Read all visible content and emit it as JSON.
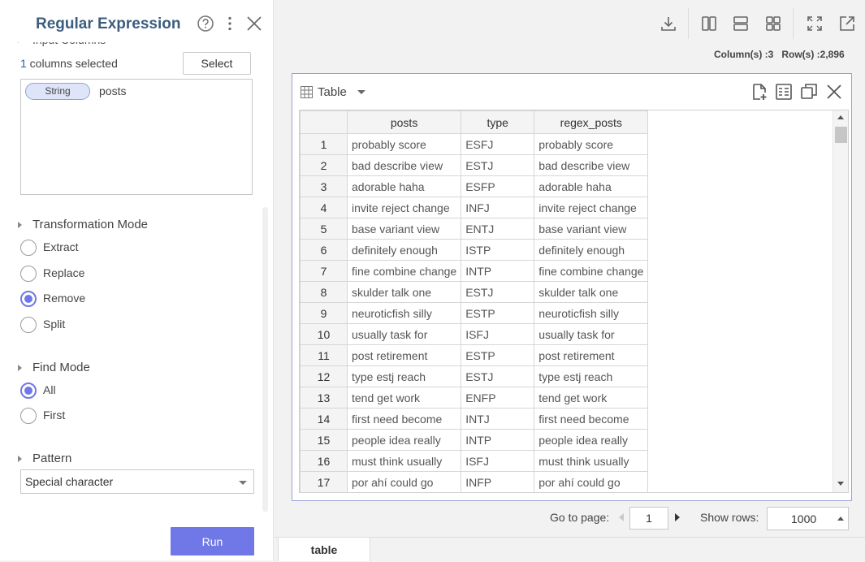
{
  "panel": {
    "title": "Regular Expression",
    "input_columns_label": "Input Columns",
    "columns_selected_count": "1",
    "columns_selected_text": " columns selected",
    "select_button": "Select",
    "selected_column": {
      "type": "String",
      "name": "posts"
    },
    "transformation_mode": {
      "title": "Transformation Mode",
      "options": [
        "Extract",
        "Replace",
        "Remove",
        "Split"
      ],
      "selected": "Remove"
    },
    "find_mode": {
      "title": "Find Mode",
      "options": [
        "All",
        "First"
      ],
      "selected": "All"
    },
    "pattern": {
      "title": "Pattern",
      "value": "Special character"
    },
    "run_button": "Run"
  },
  "toolbar": {
    "icons": [
      "download-icon",
      "split-columns-icon",
      "split-rows-icon",
      "grid-layout-icon",
      "fullscreen-icon",
      "open-external-icon"
    ]
  },
  "summary": {
    "columns": "Column(s) :3",
    "rows": "Row(s) :2,896"
  },
  "table_card": {
    "view_label": "Table",
    "columns": [
      "posts",
      "type",
      "regex_posts"
    ],
    "rows": [
      [
        "1",
        "probably score",
        "ESFJ",
        "probably score"
      ],
      [
        "2",
        "bad describe view",
        "ESTJ",
        "bad describe view"
      ],
      [
        "3",
        "adorable haha",
        "ESFP",
        "adorable haha"
      ],
      [
        "4",
        "invite reject change",
        "INFJ",
        "invite reject change"
      ],
      [
        "5",
        "base variant view",
        "ENTJ",
        "base variant view"
      ],
      [
        "6",
        "definitely enough",
        "ISTP",
        "definitely enough"
      ],
      [
        "7",
        "fine combine change",
        "INTP",
        "fine combine change"
      ],
      [
        "8",
        "skulder talk one",
        "ESTJ",
        "skulder talk one"
      ],
      [
        "9",
        "neuroticfish silly",
        "ESTP",
        "neuroticfish silly"
      ],
      [
        "10",
        "usually task for",
        "ISFJ",
        "usually task for"
      ],
      [
        "11",
        "post retirement",
        "ESTP",
        "post retirement"
      ],
      [
        "12",
        "type estj reach",
        "ESTJ",
        "type estj reach"
      ],
      [
        "13",
        "tend get work",
        "ENFP",
        "tend get work"
      ],
      [
        "14",
        "first need become",
        "INTJ",
        "first need become"
      ],
      [
        "15",
        "people idea really",
        "INTP",
        "people idea really"
      ],
      [
        "16",
        "must think usually",
        "ISFJ",
        "must think usually"
      ],
      [
        "17",
        "por ahí could go",
        "INFP",
        "por ahí could go"
      ]
    ]
  },
  "pagination": {
    "goto_label": "Go to page:",
    "page": "1",
    "show_rows_label": "Show rows:",
    "rows_per_page": "1000"
  },
  "bottom_tab": "table"
}
